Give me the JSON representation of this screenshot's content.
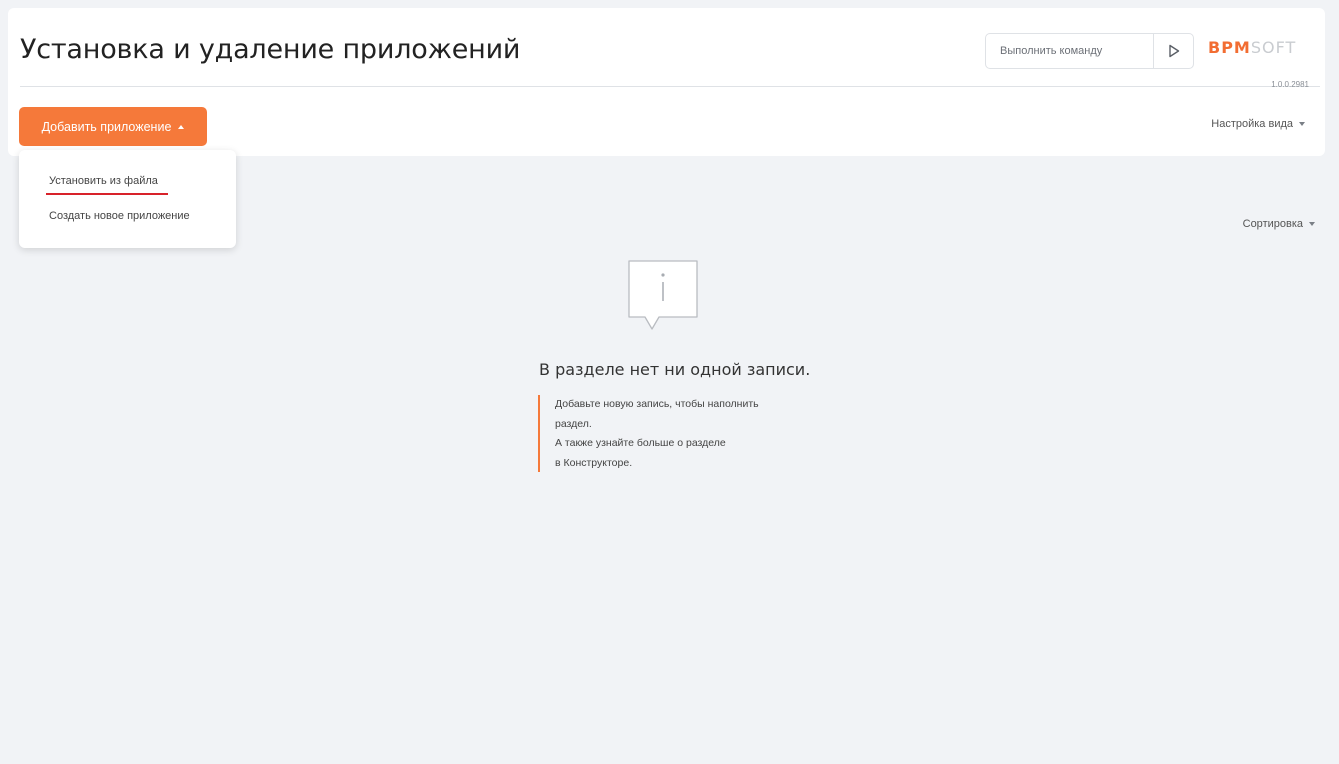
{
  "header": {
    "title": "Установка и удаление приложений",
    "command": {
      "placeholder": "Выполнить команду"
    },
    "logo": {
      "part1": "ВРМ",
      "part2": "SOFT"
    },
    "version": "1.0.0.2981"
  },
  "toolbar": {
    "add_app_label": "Добавить приложение",
    "view_settings_label": "Настройка вида"
  },
  "menu": {
    "items": [
      {
        "label": "Установить из файла"
      },
      {
        "label": "Создать новое приложение"
      }
    ]
  },
  "list": {
    "sort_label": "Сортировка"
  },
  "empty_state": {
    "title": "В разделе нет ни одной записи.",
    "lines": [
      "Добавьте новую запись, чтобы наполнить",
      "раздел.",
      "А также узнайте больше о разделе",
      "в Конструкторе."
    ]
  },
  "colors": {
    "accent": "#f5793a",
    "logo_orange": "#f26d32",
    "underline_red": "#d8222a",
    "background": "#f1f3f6"
  },
  "icons": {
    "run": "play-icon",
    "empty": "info-bubble-icon"
  }
}
